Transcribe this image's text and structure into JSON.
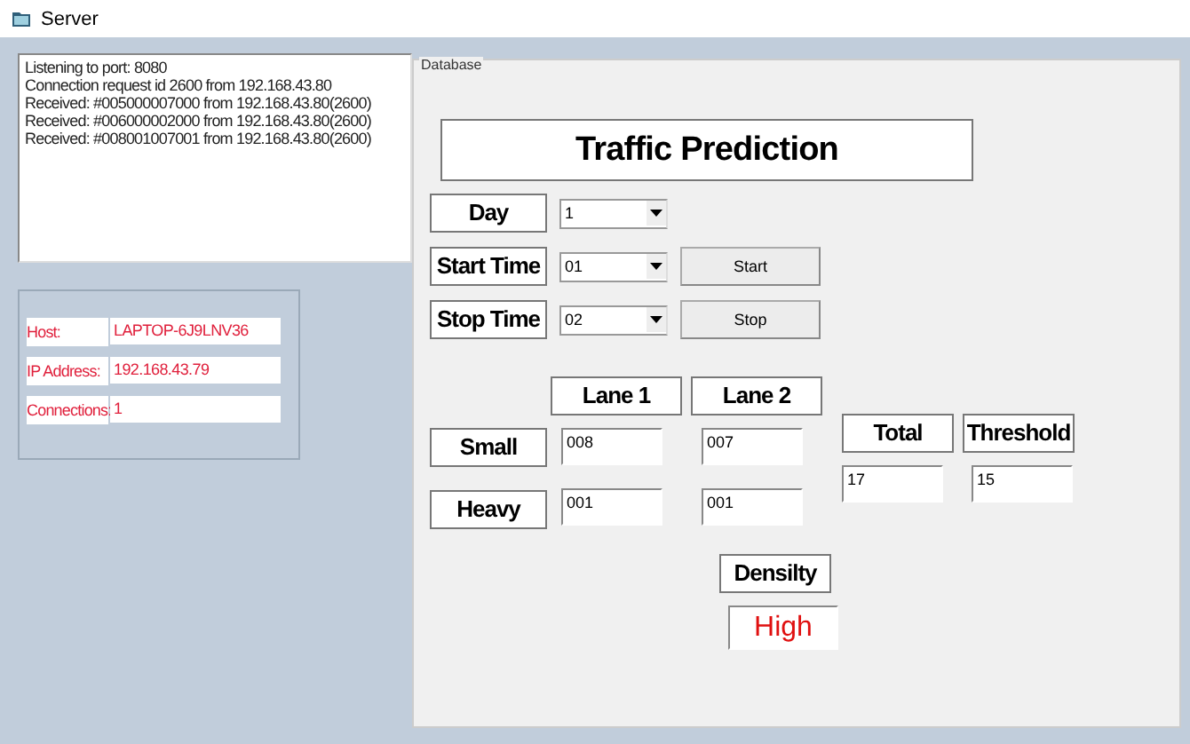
{
  "window": {
    "title": "Server"
  },
  "log": [
    "Listening to port: 8080",
    "Connection request id 2600 from 192.168.43.80",
    "Received: #005000007000 from 192.168.43.80(2600)",
    "Received: #006000002000 from 192.168.43.80(2600)",
    "Received: #008001007001 from 192.168.43.80(2600)"
  ],
  "server_info": [
    {
      "label": "Host:",
      "value": "LAPTOP-6J9LNV36"
    },
    {
      "label": "IP Address:",
      "value": "192.168.43.79"
    },
    {
      "label": "Connections:",
      "value": "1"
    }
  ],
  "database": {
    "legend": "Database",
    "title": "Traffic Prediction",
    "settings": [
      {
        "label": "Day",
        "value": "1"
      },
      {
        "label": "Start Time",
        "value": "01",
        "button": "Start"
      },
      {
        "label": "Stop Time",
        "value": "02",
        "button": "Stop"
      }
    ],
    "lanes": [
      "Lane 1",
      "Lane 2"
    ],
    "vehicles": [
      {
        "label": "Small",
        "counts": [
          "008",
          "007"
        ]
      },
      {
        "label": "Heavy",
        "counts": [
          "001",
          "001"
        ]
      }
    ],
    "total": {
      "label": "Total",
      "value": "17"
    },
    "threshold": {
      "label": "Threshold",
      "value": "15"
    },
    "density": {
      "label": "Densilty",
      "value": "High"
    }
  }
}
